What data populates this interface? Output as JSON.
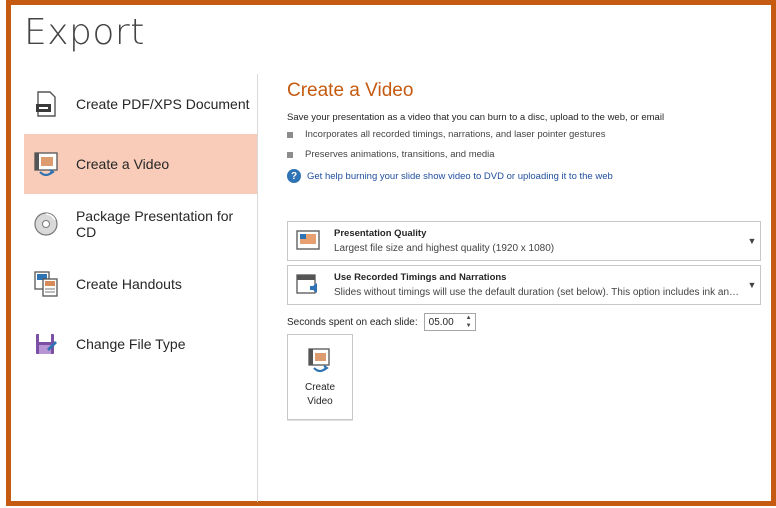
{
  "page": {
    "title": "Export"
  },
  "sidebar": {
    "items": [
      {
        "label": "Create PDF/XPS Document",
        "icon": "pdf-document-icon",
        "selected": false
      },
      {
        "label": "Create a Video",
        "icon": "video-icon",
        "selected": true
      },
      {
        "label": "Package Presentation for CD",
        "icon": "cd-icon",
        "selected": false
      },
      {
        "label": "Create Handouts",
        "icon": "handouts-icon",
        "selected": false
      },
      {
        "label": "Change File Type",
        "icon": "file-type-icon",
        "selected": false
      }
    ]
  },
  "main": {
    "title": "Create a Video",
    "description": "Save your presentation as a video that you can burn to a disc, upload to the web, or email",
    "bullets": [
      "Incorporates all recorded timings, narrations, and laser pointer gestures",
      "Preserves animations, transitions, and media"
    ],
    "help_link": "Get help burning your slide show video to DVD or uploading it to the web",
    "quality_dropdown": {
      "title": "Presentation Quality",
      "value": "Largest file size and highest quality (1920 x 1080)"
    },
    "timings_dropdown": {
      "title": "Use Recorded Timings and Narrations",
      "value": "Slides without timings will use the default duration (set below). This option includes ink and las..."
    },
    "seconds": {
      "label": "Seconds spent on each slide:",
      "value": "05.00"
    },
    "create_button": {
      "line1": "Create",
      "line2": "Video"
    }
  },
  "colors": {
    "accent": "#c55a11",
    "selected_bg": "#f8ccb8",
    "link": "#1f4e9e"
  }
}
